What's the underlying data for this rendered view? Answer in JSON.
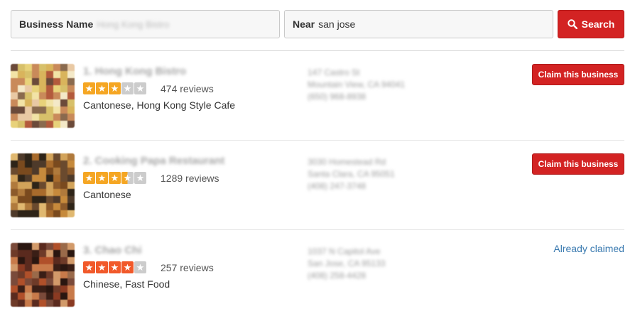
{
  "search": {
    "name_label": "Business Name",
    "name_value": "Hong Kong Bistro",
    "near_label": "Near",
    "near_value": "san jose",
    "button_label": "Search",
    "icon": "search-icon"
  },
  "colors": {
    "brand_red": "#d32323",
    "star_orange": "#f5a623",
    "star_red_orange": "#f1592a",
    "star_empty": "#cccccc",
    "link_blue": "#3a7ab0"
  },
  "results": [
    {
      "title": "1. Hong Kong Bistro",
      "rating": 3.0,
      "reviews": "474 reviews",
      "categories": "Cantonese, Hong Kong Style Cafe",
      "address_line1": "147 Castro St",
      "address_line2": "Mountain View, CA 94041",
      "phone": "(650) 968-8938",
      "action": "Claim this business",
      "claimed": false,
      "star_color": "#f5a623"
    },
    {
      "title": "2. Cooking Papa Restaurant",
      "rating": 3.5,
      "reviews": "1289 reviews",
      "categories": "Cantonese",
      "address_line1": "3030 Homestead Rd",
      "address_line2": "Santa Clara, CA 95051",
      "phone": "(408) 247-3748",
      "action": "Claim this business",
      "claimed": false,
      "star_color": "#f5a623"
    },
    {
      "title": "3. Chao Chi",
      "rating": 4.0,
      "reviews": "257 reviews",
      "categories": "Chinese, Fast Food",
      "address_line1": "1037 N Capitol Ave",
      "address_line2": "San Jose, CA 95133",
      "phone": "(408) 258-4428",
      "action": "Already claimed",
      "claimed": true,
      "star_color": "#f1592a"
    }
  ]
}
